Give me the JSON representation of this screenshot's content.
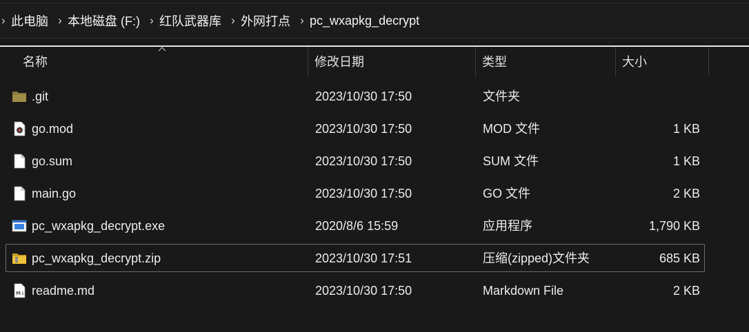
{
  "breadcrumb": {
    "items": [
      "此电脑",
      "本地磁盘 (F:)",
      "红队武器库",
      "外网打点",
      "pc_wxapkg_decrypt"
    ]
  },
  "columns": {
    "name": "名称",
    "date": "修改日期",
    "type": "类型",
    "size": "大小"
  },
  "files": [
    {
      "name": ".git",
      "date": "2023/10/30 17:50",
      "type": "文件夹",
      "size": "",
      "icon": "folder-icon"
    },
    {
      "name": "go.mod",
      "date": "2023/10/30 17:50",
      "type": "MOD 文件",
      "size": "1 KB",
      "icon": "media-file-icon"
    },
    {
      "name": "go.sum",
      "date": "2023/10/30 17:50",
      "type": "SUM 文件",
      "size": "1 KB",
      "icon": "file-icon"
    },
    {
      "name": "main.go",
      "date": "2023/10/30 17:50",
      "type": "GO 文件",
      "size": "2 KB",
      "icon": "file-icon"
    },
    {
      "name": "pc_wxapkg_decrypt.exe",
      "date": "2020/8/6 15:59",
      "type": "应用程序",
      "size": "1,790 KB",
      "icon": "application-icon"
    },
    {
      "name": "pc_wxapkg_decrypt.zip",
      "date": "2023/10/30 17:51",
      "type": "压缩(zipped)文件夹",
      "size": "685 KB",
      "icon": "zip-folder-icon"
    },
    {
      "name": "readme.md",
      "date": "2023/10/30 17:50",
      "type": "Markdown File",
      "size": "2 KB",
      "icon": "markdown-file-icon"
    }
  ],
  "colors": {
    "background": "#191919",
    "text": "#ececec",
    "folder": "#c9a227",
    "selection_border": "#6e6e6e"
  }
}
